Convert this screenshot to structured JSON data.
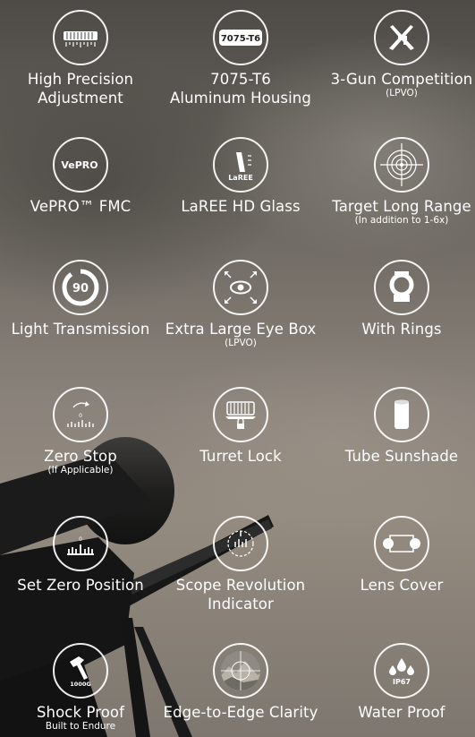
{
  "features": [
    {
      "title": "High Precision",
      "title2": "Adjustment",
      "sub": "",
      "icon": "turret-adjustment-icon"
    },
    {
      "title": "7075-T6",
      "title2": "Aluminum Housing",
      "sub": "",
      "icon": "aluminum-7075-icon",
      "badge": "7075-T6"
    },
    {
      "title": "3-Gun Competition",
      "title2": "",
      "sub": "(LPVO)",
      "icon": "crossed-rifles-icon"
    },
    {
      "title": "VePRO™ FMC",
      "title2": "",
      "sub": "",
      "icon": "vepro-coating-icon",
      "badge": "VePRO"
    },
    {
      "title": "LaREE HD Glass",
      "title2": "",
      "sub": "",
      "icon": "hd-glass-icon",
      "badge": "LaREE"
    },
    {
      "title": "Target Long Range",
      "title2": "",
      "sub": "(In addition to 1-6x)",
      "icon": "target-icon"
    },
    {
      "title": "Light Transmission",
      "title2": "",
      "sub": "",
      "icon": "light-transmission-icon",
      "badge": "90"
    },
    {
      "title": "Extra Large Eye Box",
      "title2": "",
      "sub": "(LPVO)",
      "icon": "eye-box-icon"
    },
    {
      "title": "With Rings",
      "title2": "",
      "sub": "",
      "icon": "scope-ring-icon"
    },
    {
      "title": "Zero Stop",
      "title2": "",
      "sub": "(If Applicable)",
      "icon": "zero-stop-icon",
      "badge": "0"
    },
    {
      "title": "Turret Lock",
      "title2": "",
      "sub": "",
      "icon": "turret-lock-icon"
    },
    {
      "title": "Tube Sunshade",
      "title2": "",
      "sub": "",
      "icon": "sunshade-icon"
    },
    {
      "title": "Set Zero Position",
      "title2": "",
      "sub": "",
      "icon": "set-zero-icon",
      "badge": "0"
    },
    {
      "title": "Scope Revolution",
      "title2": "Indicator",
      "sub": "",
      "icon": "revolution-indicator-icon"
    },
    {
      "title": "Lens Cover",
      "title2": "",
      "sub": "",
      "icon": "lens-cover-icon"
    },
    {
      "title": "Shock Proof",
      "title2": "",
      "sub": "Built to Endure",
      "icon": "hammer-icon",
      "badge": "1000G"
    },
    {
      "title": "Edge-to-Edge Clarity",
      "title2": "",
      "sub": "",
      "icon": "mountain-clarity-icon"
    },
    {
      "title": "Water Proof",
      "title2": "",
      "sub": "",
      "icon": "water-drops-icon",
      "badge": "IP67"
    }
  ]
}
